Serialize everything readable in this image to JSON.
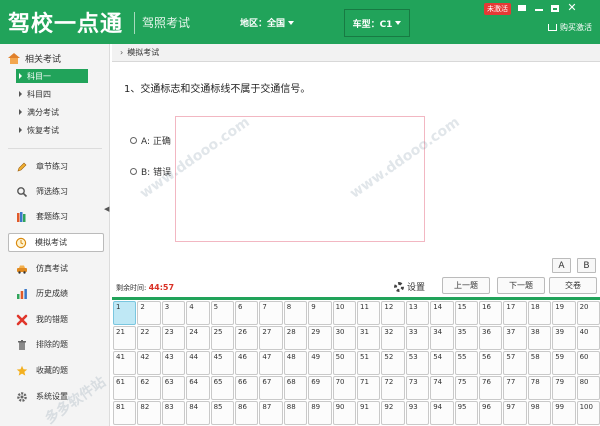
{
  "header": {
    "logo": "驾校一点通",
    "subtitle": "驾照考试",
    "region_label": "地区：全国",
    "cartype_label": "车型：C1",
    "badge": "未激活",
    "buy_label": "购买激活"
  },
  "sidebar": {
    "section_title": "相关考试",
    "sub_items": [
      {
        "label": "科目一",
        "active": true
      },
      {
        "label": "科目四",
        "active": false
      },
      {
        "label": "满分考试",
        "active": false
      },
      {
        "label": "恢复考试",
        "active": false
      }
    ],
    "nav_items": [
      {
        "label": "章节练习",
        "icon": "pencil-icon"
      },
      {
        "label": "筛选练习",
        "icon": "magnifier-icon"
      },
      {
        "label": "套题练习",
        "icon": "books-icon"
      },
      {
        "label": "模拟考试",
        "icon": "clock-icon",
        "active": true
      },
      {
        "label": "仿真考试",
        "icon": "car-icon"
      },
      {
        "label": "历史成绩",
        "icon": "bar-chart-icon"
      },
      {
        "label": "我的错题",
        "icon": "red-x-icon"
      },
      {
        "label": "排除的题",
        "icon": "trash-icon"
      },
      {
        "label": "收藏的题",
        "icon": "star-icon"
      },
      {
        "label": "系统设置",
        "icon": "gear-icon"
      }
    ]
  },
  "main": {
    "breadcrumb": "模拟考试",
    "question": "1、交通标志和交通标线不属于交通信号。",
    "options": [
      {
        "label": "A: 正确"
      },
      {
        "label": "B: 错误"
      }
    ],
    "font_a": "A",
    "font_b": "B",
    "timer_label": "剩余时间:",
    "timer_value": "44:57",
    "settings_label": "设置",
    "prev_label": "上一题",
    "next_label": "下一题",
    "submit_label": "交卷",
    "current_question": 1,
    "watermark": "www.ddooo.com",
    "watermark_cn": "多多软件站"
  },
  "colors": {
    "brand_green": "#21a35a",
    "timer_red": "#d93025",
    "current_cell": "#bfe8f5"
  }
}
